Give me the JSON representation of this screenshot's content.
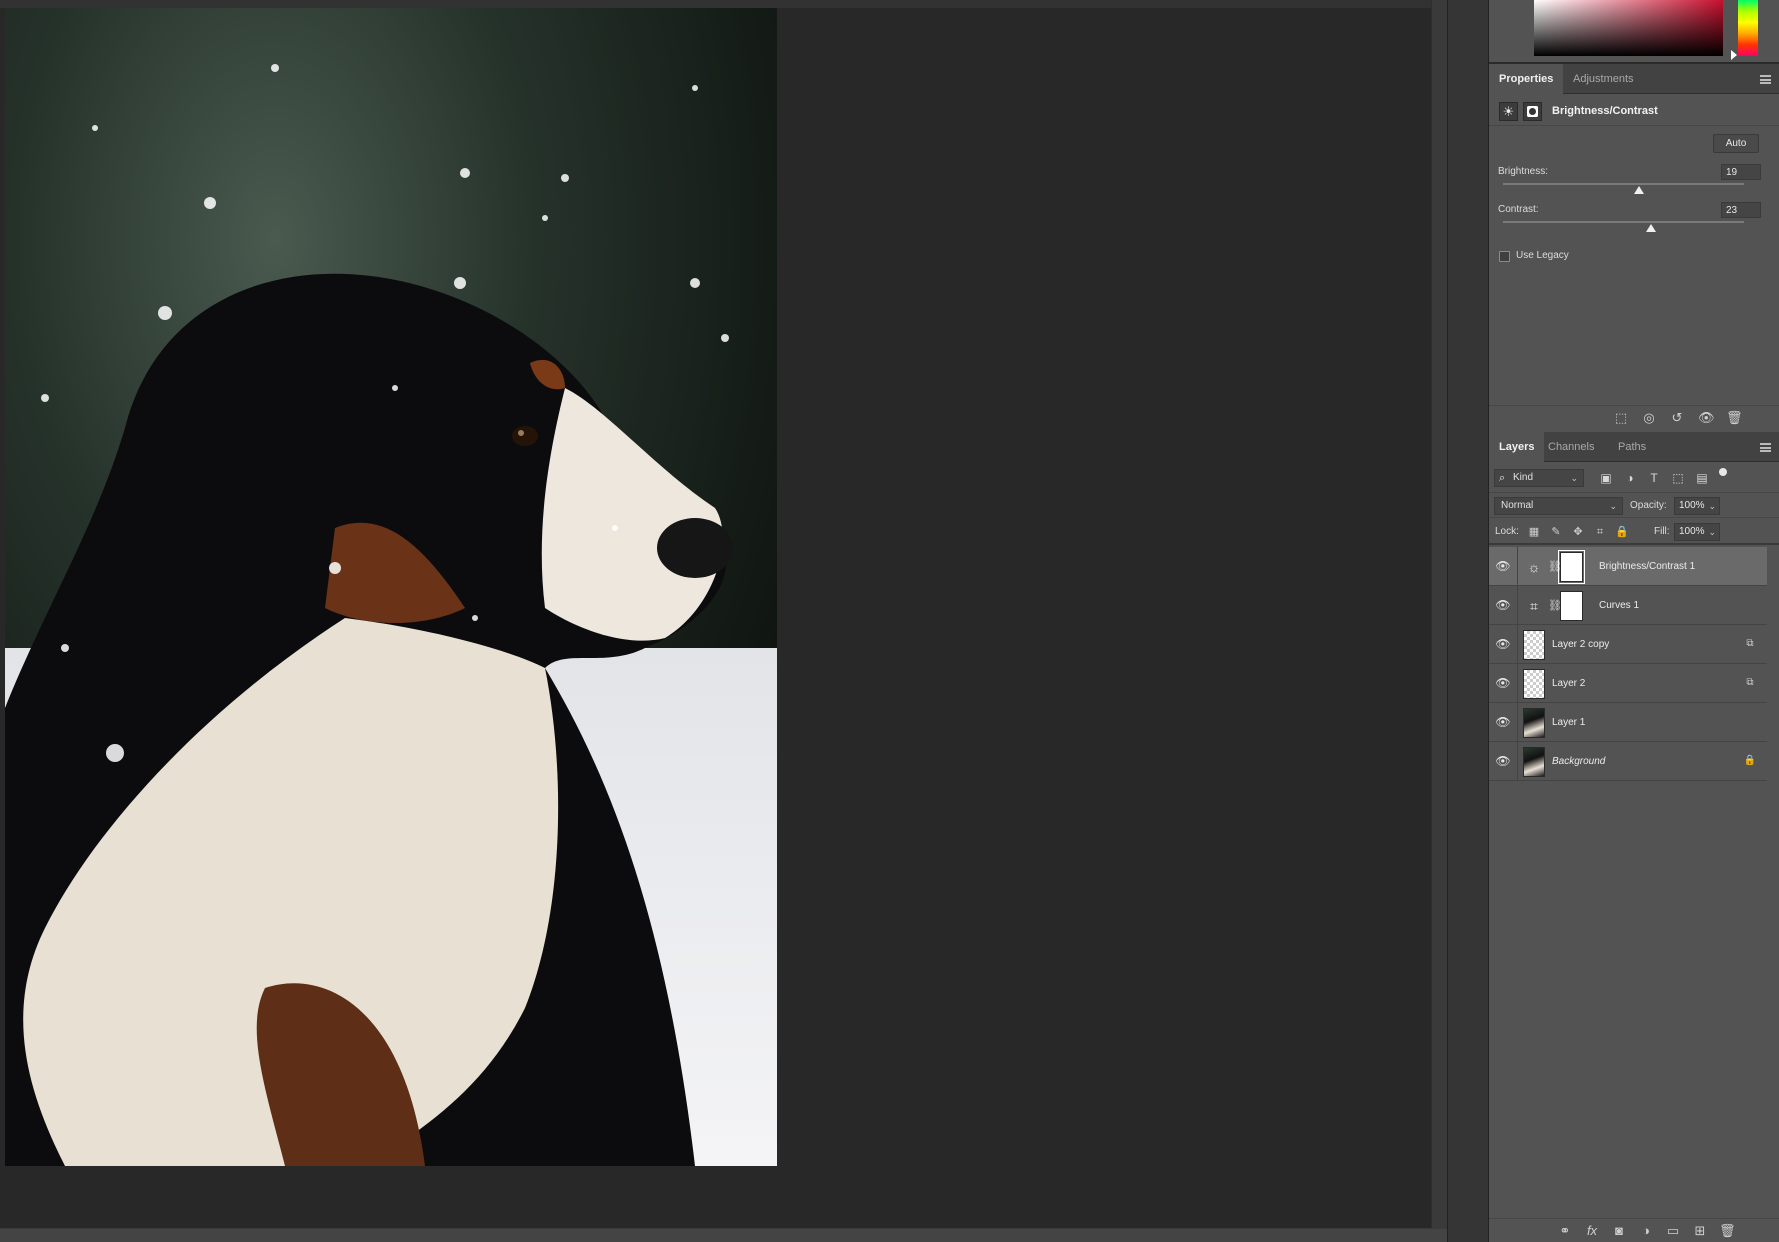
{
  "properties_panel": {
    "tabs": [
      "Properties",
      "Adjustments"
    ],
    "title": "Brightness/Contrast",
    "auto_label": "Auto",
    "brightness": {
      "label": "Brightness:",
      "value": "19",
      "level": 0.565
    },
    "contrast": {
      "label": "Contrast:",
      "value": "23",
      "level": 0.615
    },
    "use_legacy": {
      "label": "Use Legacy",
      "checked": false
    }
  },
  "layers_panel": {
    "tabs": [
      "Layers",
      "Channels",
      "Paths"
    ],
    "filter_kind": "Kind",
    "blend_mode": "Normal",
    "opacity_label": "Opacity:",
    "opacity_value": "100%",
    "lock_label": "Lock:",
    "fill_label": "Fill:",
    "fill_value": "100%",
    "layers": [
      {
        "name": "Brightness/Contrast 1",
        "type": "adjustment",
        "icon": "sun-icon",
        "selected": true
      },
      {
        "name": "Curves 1",
        "type": "adjustment",
        "icon": "curves-icon",
        "selected": false
      },
      {
        "name": "Layer 2 copy",
        "type": "transparent",
        "selected": false
      },
      {
        "name": "Layer 2",
        "type": "transparent",
        "selected": false
      },
      {
        "name": "Layer 1",
        "type": "photo",
        "selected": false
      },
      {
        "name": "Background",
        "type": "background",
        "selected": false,
        "locked": true
      }
    ]
  },
  "colors": {
    "panel_bg": "#535353",
    "canvas_bg": "#282828",
    "selected_layer": "#6a6a6a"
  }
}
